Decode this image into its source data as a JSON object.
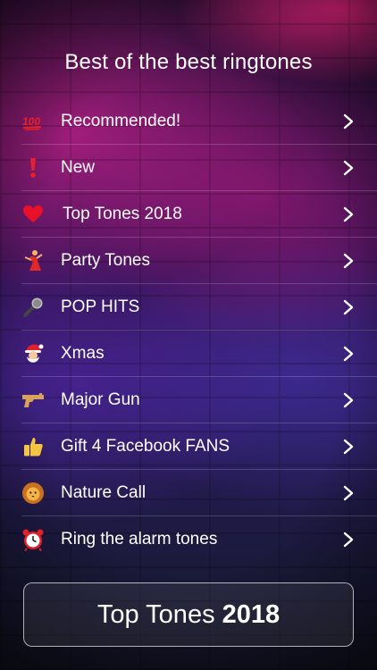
{
  "header": {
    "title": "Best of the best ringtones"
  },
  "categories": [
    {
      "label": "Recommended!",
      "icon": "hundred-points-icon"
    },
    {
      "label": "New",
      "icon": "exclamation-icon"
    },
    {
      "label": "Top Tones 2018",
      "icon": "heart-icon"
    },
    {
      "label": "Party Tones",
      "icon": "dancer-icon"
    },
    {
      "label": "POP HITS",
      "icon": "microphone-icon"
    },
    {
      "label": "Xmas",
      "icon": "santa-icon"
    },
    {
      "label": "Major Gun",
      "icon": "pistol-icon"
    },
    {
      "label": "Gift 4 Facebook FANS",
      "icon": "thumbs-up-icon"
    },
    {
      "label": "Nature Call",
      "icon": "lion-icon"
    },
    {
      "label": "Ring the alarm tones",
      "icon": "alarm-clock-icon"
    }
  ],
  "cta": {
    "text_regular": "Top Tones",
    "text_bold": "2018"
  },
  "colors": {
    "accent_pink": "#ff2a8c",
    "accent_purple": "#5a3cc8"
  }
}
